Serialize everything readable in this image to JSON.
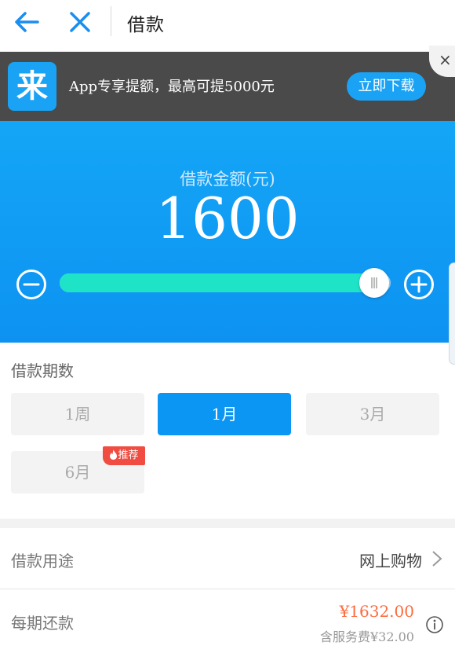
{
  "nav": {
    "title": "借款",
    "back_icon": "arrow-left-icon",
    "close_icon": "close-icon"
  },
  "banner": {
    "logo_text": "来",
    "promo": "App专享提额，最高可提5000元",
    "download_label": "立即下载",
    "dismiss": "×"
  },
  "amount": {
    "label": "借款金额(元)",
    "value": "1600",
    "slider_fraction": 0.95
  },
  "term": {
    "title": "借款期数",
    "options": [
      {
        "label": "1周",
        "selected": false
      },
      {
        "label": "1月",
        "selected": true
      },
      {
        "label": "3月",
        "selected": false
      },
      {
        "label": "6月",
        "selected": false
      }
    ],
    "recommend_badge": "推荐"
  },
  "purpose": {
    "label": "借款用途",
    "value": "网上购物"
  },
  "repay": {
    "label": "每期还款",
    "amount": "¥1632.00",
    "fee": "含服务费¥32.00"
  },
  "colors": {
    "primary": "#0c96f3",
    "slider_fill": "#1ee3c7",
    "accent": "#ff6a3d",
    "badge": "#f04c41"
  }
}
